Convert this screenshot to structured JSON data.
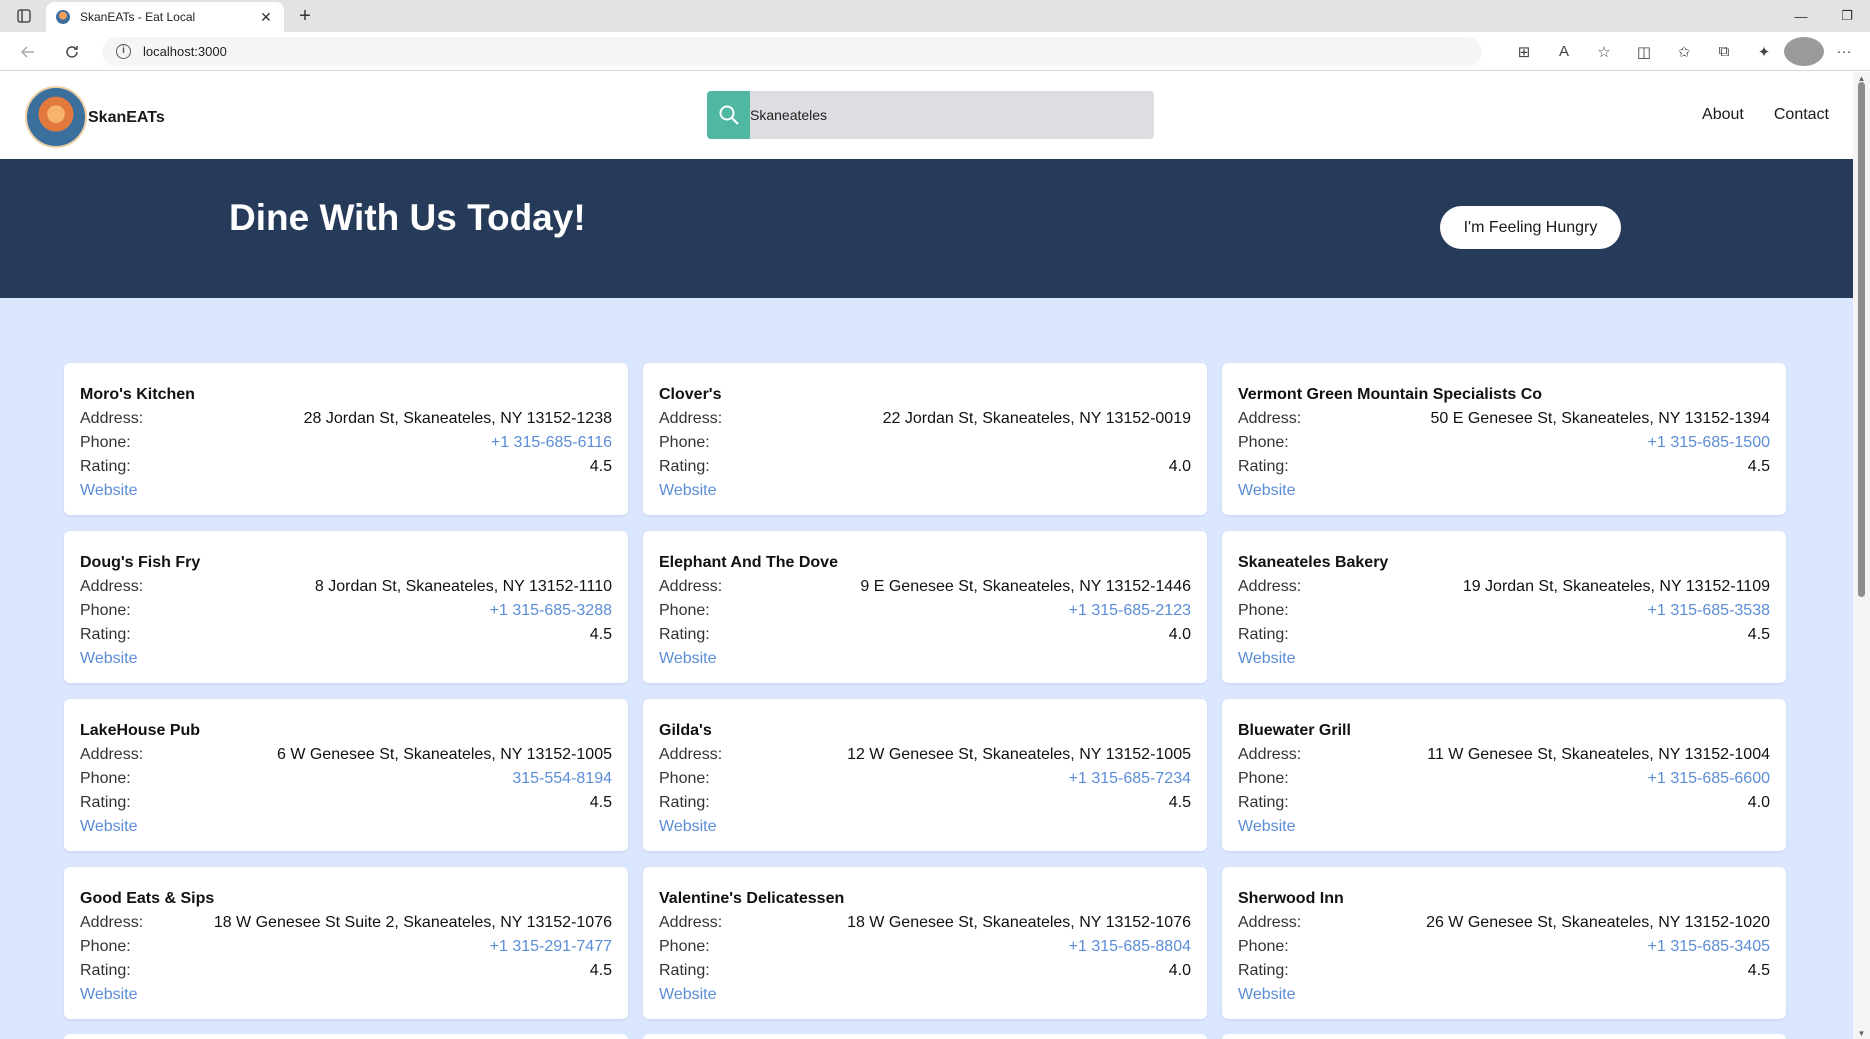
{
  "browser": {
    "tab_title": "SkanEATs - Eat Local",
    "url": "localhost:3000"
  },
  "header": {
    "logo_text": "SkanEATs",
    "search_value": "Skaneateles",
    "nav": [
      "About",
      "Contact"
    ]
  },
  "hero": {
    "title": "Dine With Us Today!",
    "button_label": "I'm Feeling Hungry"
  },
  "labels": {
    "address": "Address:",
    "phone": "Phone:",
    "rating": "Rating:",
    "website": "Website"
  },
  "restaurants": [
    {
      "name": "Moro's Kitchen",
      "address": "28 Jordan St, Skaneateles, NY 13152-1238",
      "phone": "+1 315-685-6116",
      "rating": "4.5"
    },
    {
      "name": "Clover's",
      "address": "22 Jordan St, Skaneateles, NY 13152-0019",
      "phone": "",
      "rating": "4.0"
    },
    {
      "name": "Vermont Green Mountain Specialists Co",
      "address": "50 E Genesee St, Skaneateles, NY 13152-1394",
      "phone": "+1 315-685-1500",
      "rating": "4.5"
    },
    {
      "name": "Doug's Fish Fry",
      "address": "8 Jordan St, Skaneateles, NY 13152-1110",
      "phone": "+1 315-685-3288",
      "rating": "4.5"
    },
    {
      "name": "Elephant And The Dove",
      "address": "9 E Genesee St, Skaneateles, NY 13152-1446",
      "phone": "+1 315-685-2123",
      "rating": "4.0"
    },
    {
      "name": "Skaneateles Bakery",
      "address": "19 Jordan St, Skaneateles, NY 13152-1109",
      "phone": "+1 315-685-3538",
      "rating": "4.5"
    },
    {
      "name": "LakeHouse Pub",
      "address": "6 W Genesee St, Skaneateles, NY 13152-1005",
      "phone": "315-554-8194",
      "rating": "4.5"
    },
    {
      "name": "Gilda's",
      "address": "12 W Genesee St, Skaneateles, NY 13152-1005",
      "phone": "+1 315-685-7234",
      "rating": "4.5"
    },
    {
      "name": "Bluewater Grill",
      "address": "11 W Genesee St, Skaneateles, NY 13152-1004",
      "phone": "+1 315-685-6600",
      "rating": "4.0"
    },
    {
      "name": "Good Eats & Sips",
      "address": "18 W Genesee St Suite 2, Skaneateles, NY 13152-1076",
      "phone": "+1 315-291-7477",
      "rating": "4.5"
    },
    {
      "name": "Valentine's Delicatessen",
      "address": "18 W Genesee St, Skaneateles, NY 13152-1076",
      "phone": "+1 315-685-8804",
      "rating": "4.0"
    },
    {
      "name": "Sherwood Inn",
      "address": "26 W Genesee St, Skaneateles, NY 13152-1020",
      "phone": "+1 315-685-3405",
      "rating": "4.5"
    }
  ],
  "colors": {
    "hero_bg": "#263a5a",
    "page_bg": "#dbe7ff",
    "search_accent": "#4fb7a2",
    "link": "#5b8dd6"
  }
}
